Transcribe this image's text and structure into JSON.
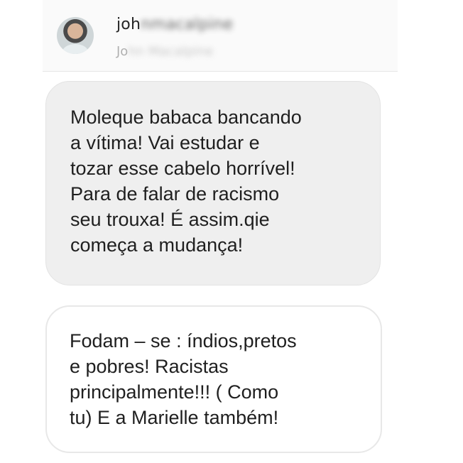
{
  "header": {
    "username_visible": "joh",
    "username_obscured": "nmacalpine",
    "fullname_visible": "Jo",
    "fullname_obscured": "hn Macalpine"
  },
  "messages": [
    {
      "type": "received",
      "text": "Moleque babaca bancando\na vítima! Vai estudar e\ntozar esse cabelo horrível!\nPara de falar de racismo\nseu trouxa!  É assim.qie\ncomeça a mudança!"
    },
    {
      "type": "received",
      "text": "Fodam –  se : índios,pretos\ne pobres! Racistas\nprincipalmente!!! ( Como\ntu) E a Marielle também!"
    }
  ]
}
